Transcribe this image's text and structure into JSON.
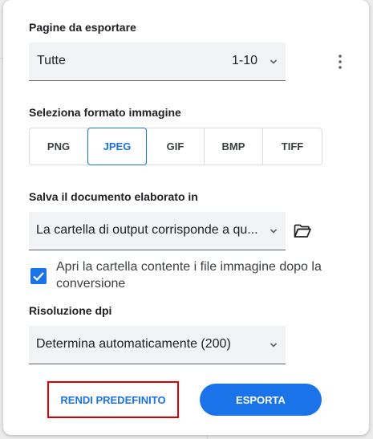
{
  "pages": {
    "label": "Pagine da esportare",
    "selected": "Tutte",
    "range": "1-10"
  },
  "format": {
    "label": "Seleziona formato immagine",
    "options": [
      "PNG",
      "JPEG",
      "GIF",
      "BMP",
      "TIFF"
    ],
    "selected": "JPEG"
  },
  "output": {
    "label": "Salva il documento elaborato in",
    "selected": "La cartella di output corrisponde a qu..."
  },
  "open_folder": {
    "checked": true,
    "label": "Apri la cartella contente i file immagine dopo la conversione"
  },
  "dpi": {
    "label": "Risoluzione dpi",
    "selected": "Determina automaticamente (200)"
  },
  "actions": {
    "default_label": "RENDI PREDEFINITO",
    "export_label": "ESPORTA"
  },
  "colors": {
    "accent": "#1a73e8",
    "highlight_border": "#e00000"
  },
  "icons": [
    "more-vert-icon",
    "chevron-down-icon",
    "folder-open-icon",
    "check-icon"
  ]
}
